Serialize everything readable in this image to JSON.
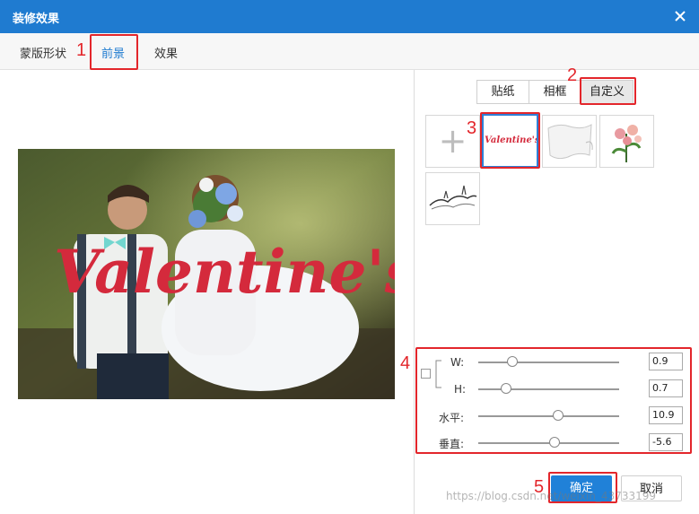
{
  "window": {
    "title": "装修效果"
  },
  "tabs": [
    {
      "label": "蒙版形状"
    },
    {
      "label": "前景"
    },
    {
      "label": "效果"
    }
  ],
  "subtabs": [
    {
      "label": "贴纸"
    },
    {
      "label": "相框"
    },
    {
      "label": "自定义"
    }
  ],
  "preview": {
    "overlay_text": "Valentine's"
  },
  "thumbnails": [
    {
      "label": "+"
    },
    {
      "label": "Valentine's"
    }
  ],
  "sliders": [
    {
      "label": "W:",
      "value": "0.9",
      "level": 0.24
    },
    {
      "label": "H:",
      "value": "0.7",
      "level": 0.2
    },
    {
      "label": "水平:",
      "value": "10.9",
      "level": 0.57
    },
    {
      "label": "垂直:",
      "value": "-5.6",
      "level": 0.54
    }
  ],
  "buttons": {
    "ok": "确定",
    "cancel": "取消"
  },
  "annotations": [
    "1",
    "2",
    "3",
    "4",
    "5"
  ],
  "watermark": "https://blog.csdn.net/weixin_43733199",
  "colors": {
    "accent": "#1f7bd0",
    "annotation": "#e3262b"
  }
}
